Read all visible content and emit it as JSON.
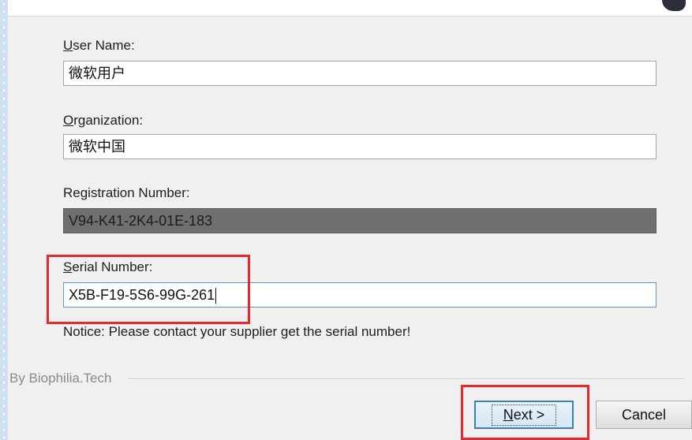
{
  "form": {
    "user_name": {
      "label_accel": "U",
      "label_rest": "ser Name:",
      "value": "微软用户"
    },
    "organization": {
      "label_accel": "O",
      "label_rest": "rganization:",
      "value": "微软中国"
    },
    "registration": {
      "label": "Registration Number:",
      "value": "V94-K41-2K4-01E-183"
    },
    "serial": {
      "label_accel": "S",
      "label_rest": "erial Number:",
      "value": "X5B-F19-5S6-99G-261"
    },
    "notice": "Notice: Please contact your supplier get the serial number!"
  },
  "footer": {
    "credit": "By Biophilia.Tech"
  },
  "buttons": {
    "next_accel": "N",
    "next_rest": "ext >",
    "cancel": "Cancel"
  },
  "colors": {
    "highlight": "#e8282e",
    "dialog_bg": "#f0f0f0",
    "disabled_field": "#6f6f6f"
  }
}
